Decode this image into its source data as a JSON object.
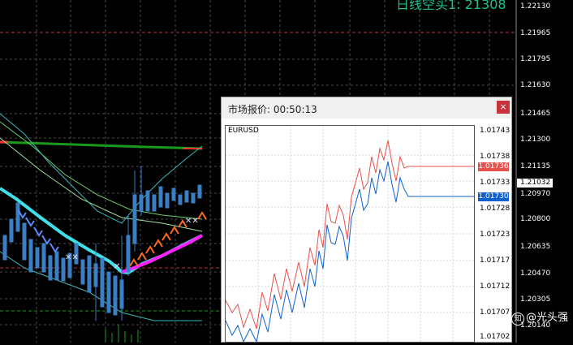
{
  "main_chart": {
    "title_overlay": "日线空买1: 21308",
    "price_axis_labels": [
      "1.22130",
      "1.21965",
      "1.21795",
      "1.21630",
      "1.21465",
      "1.21300",
      "1.21135",
      "1.20970",
      "1.20800",
      "1.20635",
      "1.20470",
      "1.20305",
      "1.20140"
    ],
    "current_price": "1.21032",
    "colors": {
      "background": "#000000",
      "grid": "#555555",
      "candle": "#3a7fc4",
      "cyan_ma": "#40e0e8",
      "magenta_ma": "#ff20ff",
      "green_ma": "#1a9a1a",
      "red_level": "#ff3030"
    }
  },
  "quote_window": {
    "title": "市场报价: 00:50:13",
    "close_label": "×",
    "symbol": "EURUSD",
    "price_axis_labels": [
      "1.01743",
      "1.01738",
      "1.01733",
      "1.01728",
      "1.01723",
      "1.01717",
      "1.01712",
      "1.01707",
      "1.01702"
    ],
    "ask_price": "1.01736",
    "bid_price": "1.01730",
    "colors": {
      "ask": "#e8504c",
      "bid": "#1060d0"
    }
  },
  "watermark": {
    "icon": "zhihu-icon",
    "text": "@光头强"
  }
}
